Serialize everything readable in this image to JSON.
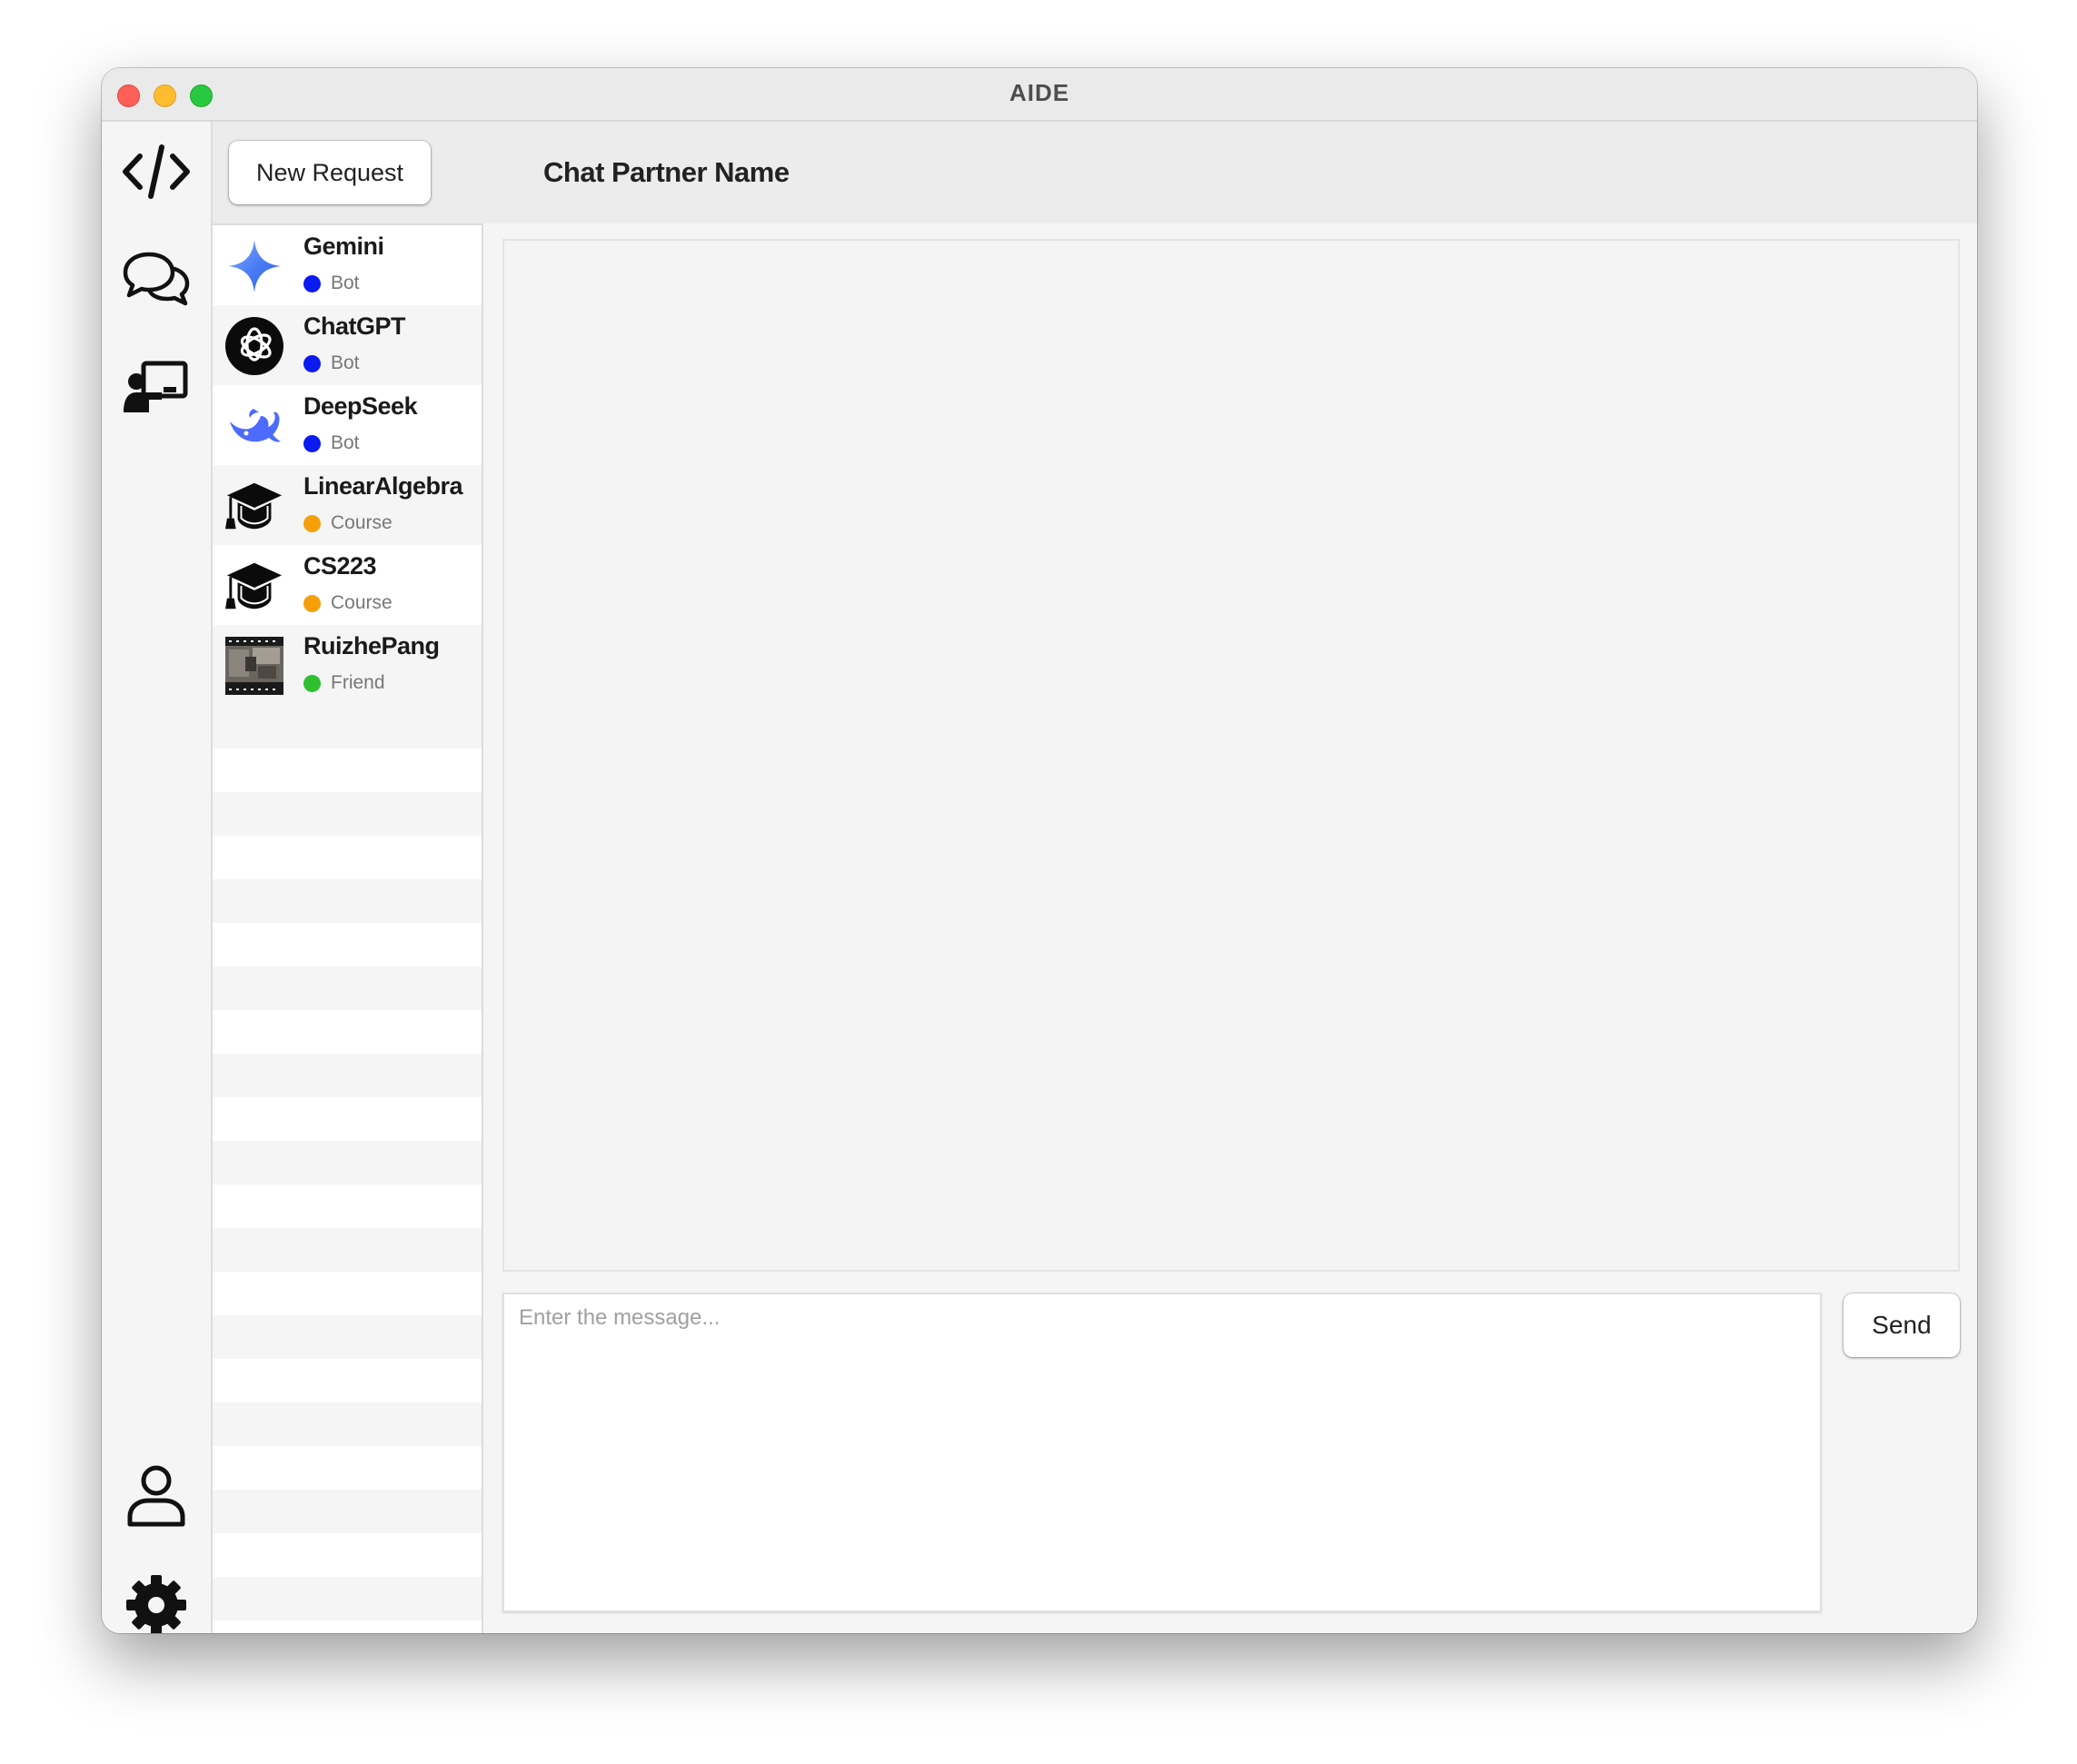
{
  "window": {
    "title": "AIDE"
  },
  "nav": {
    "items": [
      {
        "icon": "code-icon",
        "label": "Code"
      },
      {
        "icon": "chat-bubbles-icon",
        "label": "Chats"
      },
      {
        "icon": "teacher-board-icon",
        "label": "Courses"
      },
      {
        "icon": "user-profile-icon",
        "label": "Profile"
      },
      {
        "icon": "gear-icon",
        "label": "Settings"
      }
    ]
  },
  "sidebar": {
    "new_request_label": "New Request",
    "contacts": [
      {
        "name": "Gemini",
        "type": "Bot",
        "type_color": "#0a1bf0",
        "avatar": "gemini-star-icon"
      },
      {
        "name": "ChatGPT",
        "type": "Bot",
        "type_color": "#0a1bf0",
        "avatar": "chatgpt-logo-icon"
      },
      {
        "name": "DeepSeek",
        "type": "Bot",
        "type_color": "#0a1bf0",
        "avatar": "deepseek-whale-icon"
      },
      {
        "name": "LinearAlgebra",
        "type": "Course",
        "type_color": "#f5a00a",
        "avatar": "graduation-cap-icon"
      },
      {
        "name": "CS223",
        "type": "Course",
        "type_color": "#f5a00a",
        "avatar": "graduation-cap-icon"
      },
      {
        "name": "RuizhePang",
        "type": "Friend",
        "type_color": "#2ec02e",
        "avatar": "friend-photo"
      }
    ]
  },
  "chat": {
    "partner_name": "Chat Partner Name",
    "input_placeholder": "Enter the message...",
    "send_label": "Send"
  }
}
